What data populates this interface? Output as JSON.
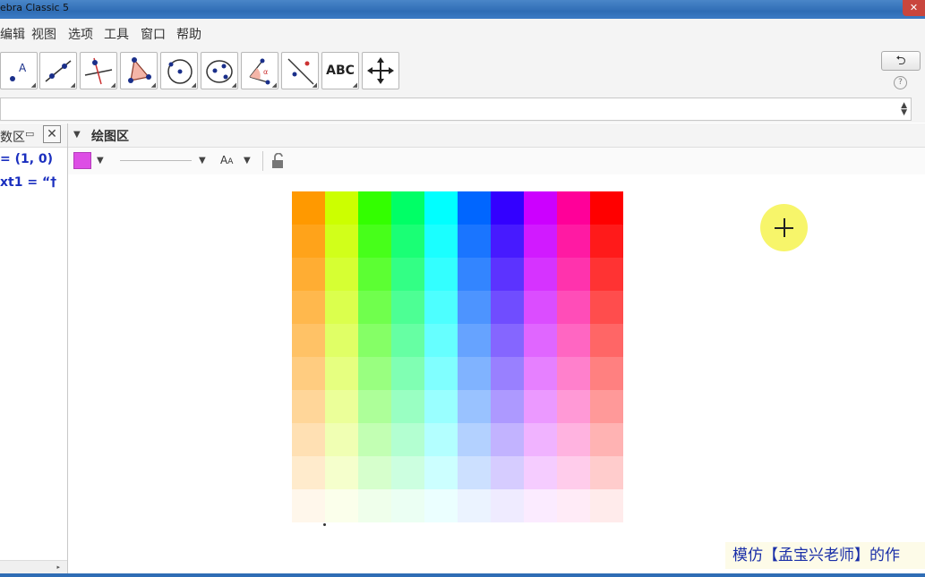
{
  "window": {
    "title": "ebra Classic 5",
    "close_glyph": "✕"
  },
  "menu": [
    "编辑",
    "视图",
    "选项",
    "工具",
    "窗口",
    "帮助"
  ],
  "toolbar": {
    "tools": [
      {
        "name": "point-tool-icon"
      },
      {
        "name": "line-tool-icon"
      },
      {
        "name": "perpendicular-line-tool-icon"
      },
      {
        "name": "polygon-tool-icon"
      },
      {
        "name": "circle-center-point-tool-icon"
      },
      {
        "name": "ellipse-tool-icon"
      },
      {
        "name": "angle-tool-icon"
      },
      {
        "name": "reflect-tool-icon"
      },
      {
        "name": "text-tool-icon",
        "label": "ABC"
      },
      {
        "name": "move-graphics-view-tool-icon"
      }
    ],
    "undo_glyph": "⮌",
    "help_glyph": "?"
  },
  "input_bar": {
    "value": "",
    "spinner": "▲▼"
  },
  "algebra": {
    "header_title": "数区",
    "restore_glyph": "▭",
    "close_glyph": "✕",
    "items": [
      "= (1, 0)",
      "xt1 = “†"
    ],
    "scroll_glyph": "▸"
  },
  "graphics": {
    "header_title": "绘图区",
    "collapse_glyph": "▼",
    "style_color": "#dd4ee5",
    "dropdown_glyph": "▼",
    "font_size_glyph": "A"
  },
  "color_grid": {
    "columns": [
      "#ff9900",
      "#ccff00",
      "#33ff00",
      "#00ff66",
      "#00ffff",
      "#0066ff",
      "#3300ff",
      "#cc00ff",
      "#ff0099",
      "#ff0000"
    ],
    "rows": 10,
    "fade_steps": [
      0,
      0.1,
      0.2,
      0.3,
      0.4,
      0.5,
      0.6,
      0.7,
      0.8,
      0.92
    ]
  },
  "caption": "模仿【孟宝兴老师】的作"
}
